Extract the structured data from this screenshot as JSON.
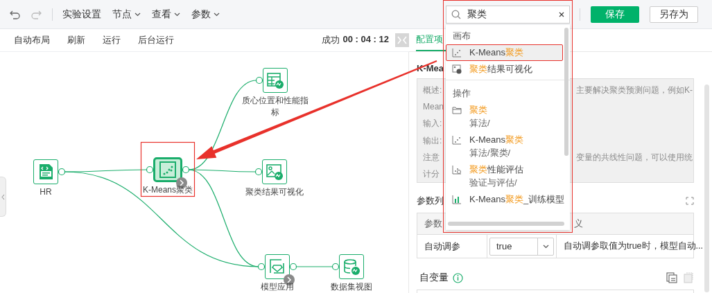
{
  "toolbar": {
    "menus": [
      {
        "label": "实验设置",
        "dropdown": false
      },
      {
        "label": "节点",
        "dropdown": true
      },
      {
        "label": "查看",
        "dropdown": true
      },
      {
        "label": "参数",
        "dropdown": true
      }
    ],
    "save_button": "保存",
    "save_as_button": "另存为"
  },
  "canvas_toolbar": [
    "自动布局",
    "刷新",
    "运行",
    "后台运行"
  ],
  "run_status": {
    "label": "成功",
    "time": "00 : 04 : 12"
  },
  "panel_tabs": [
    {
      "label": "配置项",
      "selected": true
    }
  ],
  "nodes": [
    {
      "label": "HR",
      "kind": "sql",
      "selected": false,
      "run_badge": false
    },
    {
      "label": "K-Means聚类",
      "kind": "scatter",
      "selected": true,
      "run_badge": true
    },
    {
      "label": "质心位置和性能指标",
      "kind": "table",
      "selected": false,
      "run_badge": false
    },
    {
      "label": "聚类结果可视化",
      "kind": "image",
      "selected": false,
      "run_badge": false
    },
    {
      "label": "模型应用",
      "kind": "model",
      "selected": false,
      "run_badge": true
    },
    {
      "label": "数据集视图",
      "kind": "database",
      "selected": false,
      "run_badge": false
    }
  ],
  "panel": {
    "title": "K-Mea",
    "description": [
      {
        "left": "概述:",
        "right": "主要解决聚类预测问题，例如K-"
      },
      {
        "left": "Mean"
      },
      {
        "left": "输入:"
      },
      {
        "left": "输出:"
      },
      {
        "left": "注意",
        "right": "变量的共线性问题，可以使用统"
      },
      {
        "left": "计分"
      }
    ],
    "params_title": "参数列",
    "param_columns": {
      "column_1": "参数",
      "column_3": "义"
    },
    "params": [
      {
        "name": "自动调参",
        "value": "true",
        "description": "自动调参取值为true时，模型自动..."
      }
    ],
    "variables_title": "自变量"
  },
  "search": {
    "value": "聚类",
    "results": [
      {
        "title": "画布",
        "items": [
          {
            "kind": "scatter",
            "before": "K-Means",
            "match": "聚类",
            "selected": true
          },
          {
            "kind": "image",
            "match": "聚类",
            "after": "结果可视化",
            "selected": false
          }
        ]
      },
      {
        "title": "操作",
        "items": [
          {
            "kind": "folder",
            "match": "聚类",
            "path": "算法/",
            "selected": false
          },
          {
            "kind": "scatter",
            "before": "K-Means",
            "match": "聚类",
            "path": "算法/聚类/",
            "selected": false
          },
          {
            "kind": "evaluate",
            "match": "聚类",
            "after": "性能评估",
            "path": "验证与评估/",
            "selected": false
          },
          {
            "kind": "bar",
            "before": "K-Means",
            "match": "聚类",
            "after": "_训练模型",
            "selected": false
          }
        ]
      }
    ]
  }
}
